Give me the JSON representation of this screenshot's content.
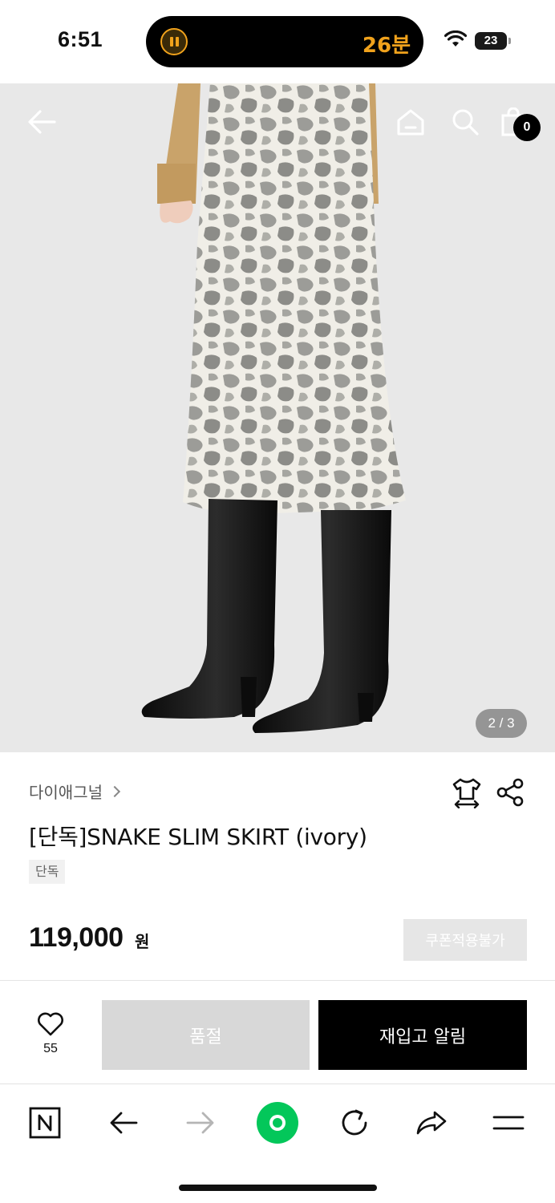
{
  "status_bar": {
    "time": "6:51",
    "island_timer": "26분",
    "battery_level": "23"
  },
  "hero": {
    "image_counter": "2 / 3",
    "cart_count": "0"
  },
  "product": {
    "brand": "다이애그널",
    "title": "[단독]SNAKE SLIM SKIRT (ivory)",
    "tag": "단독",
    "price": "119,000",
    "price_unit": "원",
    "coupon_label": "쿠폰적용불가"
  },
  "actions": {
    "like_count": "55",
    "soldout_label": "품절",
    "restock_label": "재입고 알림"
  },
  "colors": {
    "accent_timer": "#f0a21c",
    "naver_green": "#03c75a",
    "soldout_bg": "#d8d8d8",
    "primary_button": "#000000"
  }
}
